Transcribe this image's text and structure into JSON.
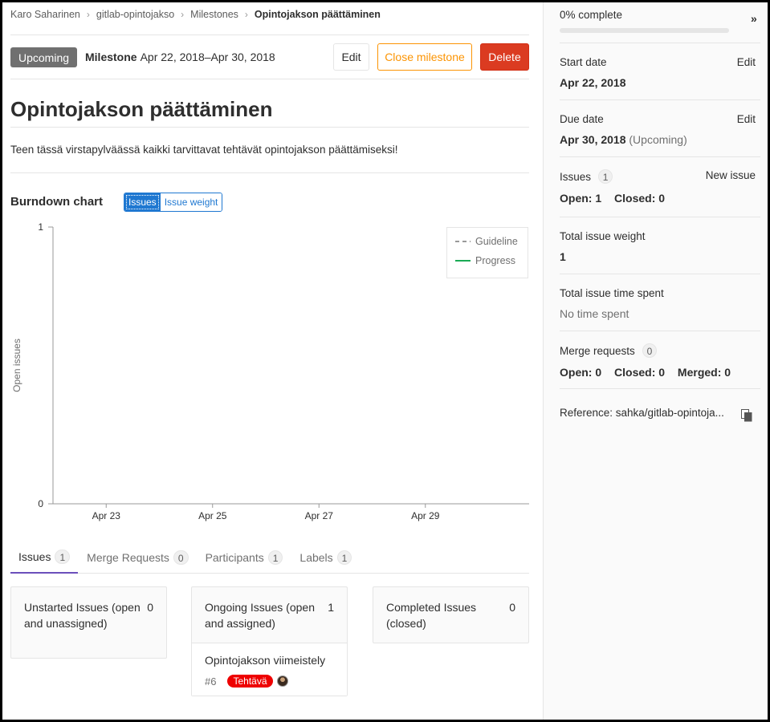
{
  "breadcrumb": {
    "items": [
      "Karo Saharinen",
      "gitlab-opintojakso",
      "Milestones"
    ],
    "current": "Opintojakson päättäminen"
  },
  "header": {
    "status_badge": "Upcoming",
    "milestone_label": "Milestone",
    "date_range": "Apr 22, 2018–Apr 30, 2018",
    "edit_label": "Edit",
    "close_label": "Close milestone",
    "delete_label": "Delete"
  },
  "title": "Opintojakson päättäminen",
  "description": "Teen tässä virstapylväässä kaikki tarvittavat tehtävät opintojakson päättämiseksi!",
  "burndown": {
    "title": "Burndown chart",
    "toggle": {
      "issues": "Issues",
      "weight": "Issue weight",
      "active": "issues"
    },
    "legend": {
      "guideline": "Guideline",
      "progress": "Progress"
    },
    "colors": {
      "guideline": "#999999",
      "progress": "#1aaa55",
      "axis": "#999999"
    }
  },
  "chart_data": {
    "type": "line",
    "title": "Burndown chart",
    "xlabel": "",
    "ylabel": "Open issues",
    "x_ticks": [
      "Apr 23",
      "Apr 25",
      "Apr 27",
      "Apr 29"
    ],
    "xlim": [
      "Apr 22",
      "Apr 30"
    ],
    "ylim": [
      0,
      1
    ],
    "y_ticks": [
      0,
      1
    ],
    "series": [
      {
        "name": "Guideline",
        "values": []
      },
      {
        "name": "Progress",
        "values": []
      }
    ],
    "legend_position": "top-right",
    "grid": false
  },
  "tabs": [
    {
      "label": "Issues",
      "count": "1",
      "active": true
    },
    {
      "label": "Merge Requests",
      "count": "0",
      "active": false
    },
    {
      "label": "Participants",
      "count": "1",
      "active": false
    },
    {
      "label": "Labels",
      "count": "1",
      "active": false
    }
  ],
  "boards": {
    "unstarted": {
      "title": "Unstarted Issues (open and unassigned)",
      "count": "0"
    },
    "ongoing": {
      "title": "Ongoing Issues (open and assigned)",
      "count": "1",
      "issue": {
        "title": "Opintojakson viimeistely",
        "ref": "#6",
        "label": "Tehtävä",
        "label_color": "#ee0000"
      }
    },
    "completed": {
      "title": "Completed Issues (closed)",
      "count": "0"
    }
  },
  "sidebar": {
    "progress": {
      "label": "0% complete",
      "percent": 0
    },
    "start_date": {
      "label": "Start date",
      "value": "Apr 22, 2018",
      "edit": "Edit"
    },
    "due_date": {
      "label": "Due date",
      "value": "Apr 30, 2018",
      "status": "(Upcoming)",
      "edit": "Edit"
    },
    "issues": {
      "label": "Issues",
      "count": "1",
      "new_issue": "New issue",
      "open": "Open: 1",
      "closed": "Closed: 0"
    },
    "weight": {
      "label": "Total issue weight",
      "value": "1"
    },
    "time_spent": {
      "label": "Total issue time spent",
      "value": "No time spent"
    },
    "merge_requests": {
      "label": "Merge requests",
      "count": "0",
      "open": "Open: 0",
      "closed": "Closed: 0",
      "merged": "Merged: 0"
    },
    "reference": {
      "label": "Reference: sahka/gitlab-opintoja..."
    }
  }
}
